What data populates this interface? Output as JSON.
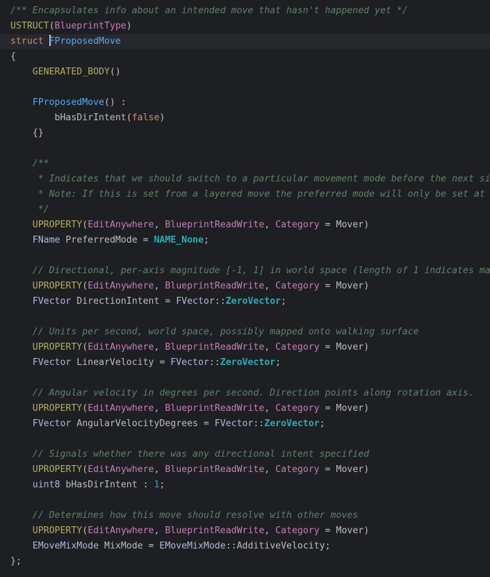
{
  "editor": {
    "lines": [
      {
        "text": "/** Encapsulates info about an intended move that hasn't happened yet */",
        "kind": "comment"
      },
      {
        "text": "USTRUCT(BlueprintType)",
        "kind": "macro"
      },
      {
        "text": "struct FProposedMove",
        "kind": "decl"
      },
      {
        "text": "{",
        "kind": "plain"
      },
      {
        "text": "    GENERATED_BODY()",
        "kind": "macro"
      },
      {
        "text": "",
        "kind": "plain"
      },
      {
        "text": "    FProposedMove() :",
        "kind": "func"
      },
      {
        "text": "        bHasDirIntent(false)",
        "kind": "plain"
      },
      {
        "text": "    {}",
        "kind": "plain"
      },
      {
        "text": "",
        "kind": "plain"
      },
      {
        "text": "    /**",
        "kind": "comment"
      },
      {
        "text": "     * Indicates that we should switch to a particular movement mode before the next si",
        "kind": "comment"
      },
      {
        "text": "     * Note: If this is set from a layered move the preferred mode will only be set at",
        "kind": "comment"
      },
      {
        "text": "     */",
        "kind": "comment"
      },
      {
        "text": "    UPROPERTY(EditAnywhere, BlueprintReadWrite, Category = Mover)",
        "kind": "macro"
      },
      {
        "text": "    FName PreferredMode = NAME_None;",
        "kind": "plain"
      },
      {
        "text": "",
        "kind": "plain"
      },
      {
        "text": "    // Directional, per-axis magnitude [-1, 1] in world space (length of 1 indicates ma",
        "kind": "comment"
      },
      {
        "text": "    UPROPERTY(EditAnywhere, BlueprintReadWrite, Category = Mover)",
        "kind": "macro"
      },
      {
        "text": "    FVector DirectionIntent = FVector::ZeroVector;",
        "kind": "plain"
      },
      {
        "text": "",
        "kind": "plain"
      },
      {
        "text": "    // Units per second, world space, possibly mapped onto walking surface",
        "kind": "comment"
      },
      {
        "text": "    UPROPERTY(EditAnywhere, BlueprintReadWrite, Category = Mover)",
        "kind": "macro"
      },
      {
        "text": "    FVector LinearVelocity = FVector::ZeroVector;",
        "kind": "plain"
      },
      {
        "text": "",
        "kind": "plain"
      },
      {
        "text": "    // Angular velocity in degrees per second. Direction points along rotation axis.",
        "kind": "comment"
      },
      {
        "text": "    UPROPERTY(EditAnywhere, BlueprintReadWrite, Category = Mover)",
        "kind": "macro"
      },
      {
        "text": "    FVector AngularVelocityDegrees = FVector::ZeroVector;",
        "kind": "plain"
      },
      {
        "text": "",
        "kind": "plain"
      },
      {
        "text": "    // Signals whether there was any directional intent specified",
        "kind": "comment"
      },
      {
        "text": "    UPROPERTY(EditAnywhere, BlueprintReadWrite, Category = Mover)",
        "kind": "macro"
      },
      {
        "text": "    uint8 bHasDirIntent : 1;",
        "kind": "plain"
      },
      {
        "text": "",
        "kind": "plain"
      },
      {
        "text": "    // Determines how this move should resolve with other moves",
        "kind": "comment"
      },
      {
        "text": "    UPROPERTY(EditAnywhere, BlueprintReadWrite, Category = Mover)",
        "kind": "macro"
      },
      {
        "text": "    EMoveMixMode MixMode = EMoveMixMode::AdditiveVelocity;",
        "kind": "plain"
      },
      {
        "text": "};",
        "kind": "plain"
      }
    ]
  },
  "colors": {
    "background": "#1e1f22",
    "current_line": "#26282e",
    "comment": "#7a9a6a",
    "macro": "#9876aa",
    "keyword": "#cc7832",
    "type": "#a9b7c6",
    "function": "#56a8f5",
    "constant": "#20999d",
    "number": "#2aacb8"
  }
}
